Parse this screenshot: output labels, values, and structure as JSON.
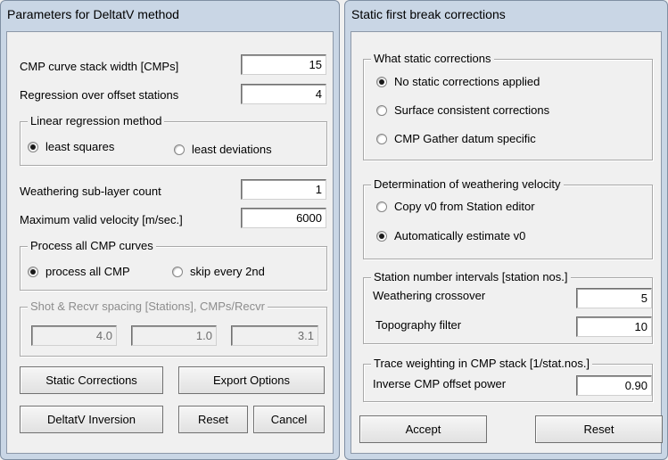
{
  "left": {
    "title": "Parameters for DeltatV method",
    "cmp_stack_width": {
      "label": "CMP curve stack width [CMPs]",
      "value": "15"
    },
    "regression_offset": {
      "label": "Regression over offset stations",
      "value": "4"
    },
    "linear_regression": {
      "title": "Linear regression method",
      "options": [
        {
          "label": "least squares",
          "checked": true
        },
        {
          "label": "least deviations",
          "checked": false
        }
      ]
    },
    "weathering_count": {
      "label": "Weathering sub-layer count",
      "value": "1"
    },
    "max_velocity": {
      "label": "Maximum valid velocity [m/sec.]",
      "value": "6000"
    },
    "process_cmp": {
      "title": "Process all CMP curves",
      "options": [
        {
          "label": "process all CMP",
          "checked": true
        },
        {
          "label": "skip every 2nd",
          "checked": false
        }
      ]
    },
    "spacing": {
      "title": "Shot & Recvr spacing [Stations], CMPs/Recvr",
      "values": [
        "4.0",
        "1.0",
        "3.1"
      ]
    },
    "buttons": {
      "static_corrections": "Static Corrections",
      "export_options": "Export Options",
      "deltatv_inversion": "DeltatV Inversion",
      "reset": "Reset",
      "cancel": "Cancel"
    }
  },
  "right": {
    "title": "Static first break corrections",
    "static_corrections": {
      "title": "What static corrections",
      "options": [
        {
          "label": "No static corrections applied",
          "checked": true
        },
        {
          "label": "Surface consistent corrections",
          "checked": false
        },
        {
          "label": "CMP Gather datum specific",
          "checked": false
        }
      ]
    },
    "weathering_velocity": {
      "title": "Determination of weathering velocity",
      "options": [
        {
          "label": "Copy v0 from Station editor",
          "checked": false
        },
        {
          "label": "Automatically estimate v0",
          "checked": true
        }
      ]
    },
    "station_intervals": {
      "title": "Station number intervals [station nos.]",
      "crossover": {
        "label": "Weathering crossover",
        "value": "5"
      },
      "topo_filter": {
        "label": "Topography filter",
        "value": "10"
      }
    },
    "trace_weighting": {
      "title": "Trace weighting in CMP stack [1/stat.nos.]",
      "offset_power": {
        "label": "Inverse CMP offset power",
        "value": "0.90"
      }
    },
    "buttons": {
      "accept": "Accept",
      "reset": "Reset"
    }
  }
}
